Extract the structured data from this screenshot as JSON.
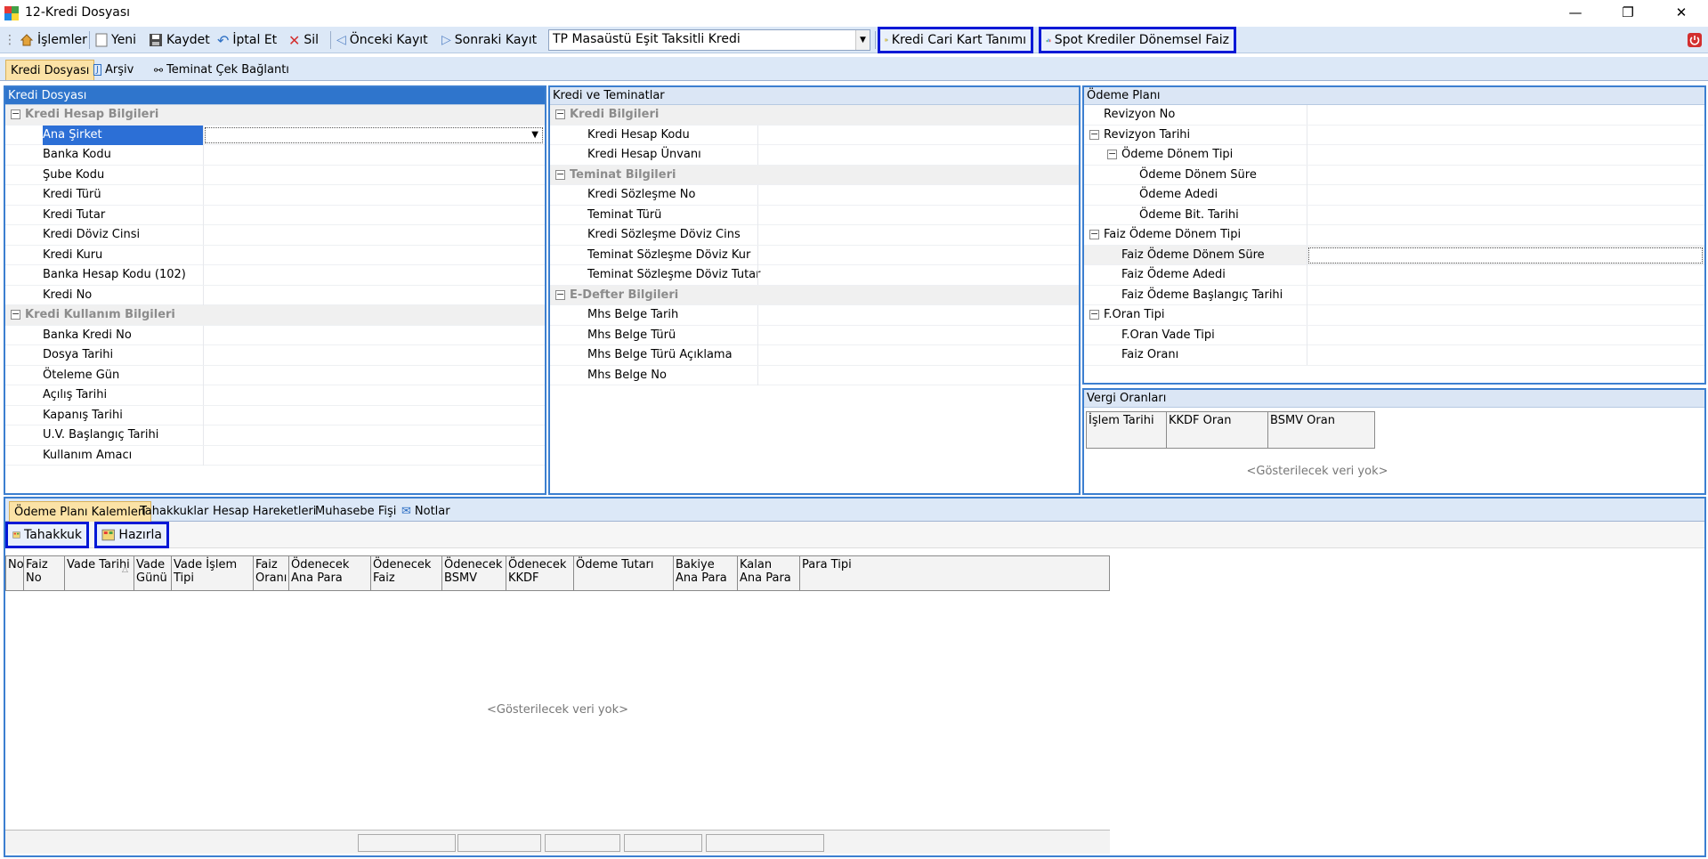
{
  "window": {
    "title": "12-Kredi Dosyası"
  },
  "toolbar": {
    "islemler": "İşlemler",
    "yeni": "Yeni",
    "kaydet": "Kaydet",
    "iptal": "İptal Et",
    "sil": "Sil",
    "onceki": "Önceki Kayıt",
    "sonraki": "Sonraki Kayıt",
    "combo_value": "TP Masaüstü Eşit Taksitli Kredi",
    "kredi_cari": "Kredi Cari Kart Tanımı",
    "spot_faiz": "Spot Krediler Dönemsel Faiz"
  },
  "top_tabs": [
    "Kredi Dosyası",
    "Arşiv",
    "Teminat Çek Bağlantı"
  ],
  "panel_kredi_dosyasi": {
    "header": "Kredi Dosyası",
    "cat1": "Kredi Hesap Bilgileri",
    "rows1": [
      "Ana Şirket",
      "Banka Kodu",
      "Şube Kodu",
      "Kredi Türü",
      "Kredi Tutar",
      "Kredi Döviz Cinsi",
      "Kredi Kuru",
      "Banka Hesap Kodu (102)",
      "Kredi No"
    ],
    "cat2": "Kredi Kullanım Bilgileri",
    "rows2": [
      "Banka Kredi No",
      "Dosya Tarihi",
      "Öteleme Gün",
      "Açılış Tarihi",
      "Kapanış Tarihi",
      "U.V. Başlangıç Tarihi",
      "Kullanım Amacı"
    ]
  },
  "panel_kredi_teminat": {
    "header": "Kredi ve Teminatlar",
    "cat1": "Kredi Bilgileri",
    "rows1": [
      "Kredi Hesap Kodu",
      "Kredi Hesap Ünvanı"
    ],
    "cat2": "Teminat Bilgileri",
    "rows2": [
      "Kredi Sözleşme No",
      "Teminat Türü",
      "Kredi Sözleşme Döviz Cins",
      "Teminat Sözleşme Döviz Kur",
      "Teminat Sözleşme Döviz Tutar"
    ],
    "cat3": "E-Defter Bilgileri",
    "rows3": [
      "Mhs Belge Tarih",
      "Mhs Belge Türü",
      "Mhs Belge Türü Açıklama",
      "Mhs Belge No"
    ]
  },
  "panel_odeme_plani": {
    "header": "Ödeme Planı",
    "rows": [
      "Revizyon No",
      "Revizyon Tarihi",
      "Ödeme Dönem Tipi",
      "Ödeme Dönem Süre",
      "Ödeme Adedi",
      "Ödeme Bit. Tarihi",
      "Faiz Ödeme Dönem Tipi",
      "Faiz Ödeme Dönem Süre",
      "Faiz Ödeme Adedi",
      "Faiz Ödeme Başlangıç Tarihi",
      "F.Oran Tipi",
      "F.Oran Vade Tipi",
      "Faiz Oranı"
    ]
  },
  "panel_vergi": {
    "header": "Vergi Oranları",
    "columns": [
      "İşlem Tarihi",
      "KKDF Oran",
      "BSMV Oran"
    ],
    "empty": "<Gösterilecek veri yok>"
  },
  "bottom_tabs": [
    "Ödeme Planı Kalemleri",
    "Tahakkuklar",
    "Hesap Hareketleri",
    "Muhasebe Fişi",
    "Notlar"
  ],
  "bottom_toolbar": {
    "tahakkuk": "Tahakkuk",
    "hazirla": "Hazırla"
  },
  "grid": {
    "columns": [
      "No",
      "Faiz No",
      "Vade Tarihi",
      "Vade Günü",
      "Vade İşlem Tipi",
      "Faiz Oranı",
      "Ödenecek Ana Para",
      "Ödenecek Faiz",
      "Ödenecek BSMV",
      "Ödenecek KKDF",
      "Ödeme Tutarı",
      "Bakiye Ana Para",
      "Kalan Ana Para",
      "Para Tipi"
    ],
    "empty": "<Gösterilecek veri yok>"
  },
  "colors": {
    "accent": "#2f75cc",
    "highlight": "#0018d6",
    "toolbar_bg": "#dce8f7",
    "active_tab": "#fbe2a6"
  }
}
